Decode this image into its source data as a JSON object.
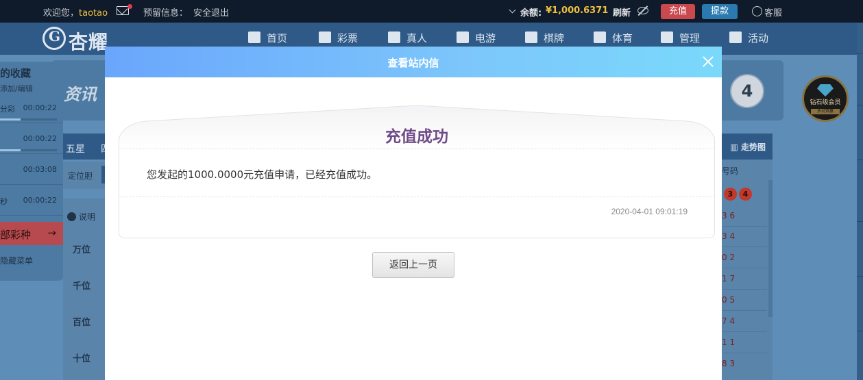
{
  "topbar": {
    "welcome": "欢迎您，",
    "username": "taotao",
    "reserve_info": "预留信息：",
    "logout": "安全退出",
    "balance_label": "余额:",
    "balance_value": "¥1,000.6371",
    "refresh": "刷新",
    "recharge": "充值",
    "withdraw": "提款",
    "service": "客服",
    "recharge_color": "#c9494f",
    "withdraw_color": "#2a7ab0"
  },
  "nav": {
    "logo_text": "杏耀",
    "items": [
      {
        "label": "首页",
        "icon": "home-icon"
      },
      {
        "label": "彩票",
        "icon": "lottery-icon"
      },
      {
        "label": "真人",
        "icon": "live-icon"
      },
      {
        "label": "电游",
        "icon": "slot-icon"
      },
      {
        "label": "棋牌",
        "icon": "cards-icon"
      },
      {
        "label": "体育",
        "icon": "trophy-icon"
      },
      {
        "label": "管理",
        "icon": "users-icon"
      },
      {
        "label": "活动",
        "icon": "gift-icon"
      }
    ]
  },
  "background": {
    "favorites_title": "的收藏",
    "favorites_sub": "添加/编辑",
    "fav_rows": [
      {
        "name": "分彩",
        "time": "00:00:22"
      },
      {
        "name": "",
        "time": "00:00:22"
      },
      {
        "name": "",
        "time": "00:03:08"
      },
      {
        "name": "秒",
        "time": "00:00:22"
      }
    ],
    "all_lottery": "部彩种",
    "hide_menu": "隐藏菜单",
    "xun": "资讯",
    "ball_number": "4",
    "badge_text": "钻石级会员",
    "badge_sub": "多对双赢",
    "tab_wuxing": "五星",
    "tab_next": "四",
    "trend": "走势图",
    "dingweidan": "定位胆",
    "info": "说明",
    "positions": [
      "万位",
      "千位",
      "百位",
      "十位"
    ],
    "code_header": "号码",
    "red_balls": [
      "3",
      "4"
    ],
    "codes": [
      "3 6",
      "3 4",
      "0 2",
      "1 7",
      "0 5",
      "7 4",
      "1 1",
      "8 3"
    ]
  },
  "modal": {
    "title": "查看站内信",
    "heading": "充值成功",
    "message": "您发起的1000.0000元充值申请，已经充值成功。",
    "timestamp": "2020-04-01 09:01:19",
    "back_button": "返回上一页",
    "header_gradient": [
      "#6aa6fc",
      "#7ad9fb"
    ],
    "heading_color": "#6f4a88"
  }
}
